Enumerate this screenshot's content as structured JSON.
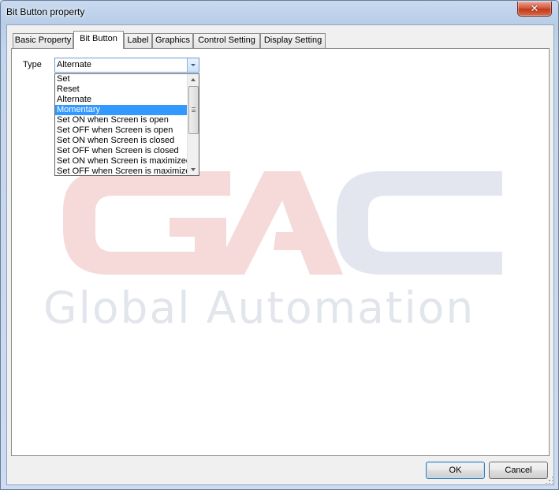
{
  "window": {
    "title": "Bit Button property",
    "close_glyph": "✕"
  },
  "tabs": [
    {
      "label": "Basic Property"
    },
    {
      "label": "Bit Button",
      "active": true
    },
    {
      "label": "Label"
    },
    {
      "label": "Graphics"
    },
    {
      "label": "Control Setting"
    },
    {
      "label": "Display Setting"
    }
  ],
  "form": {
    "type_label": "Type",
    "type_value": "Alternate",
    "type_options": [
      "Set",
      "Reset",
      "Alternate",
      "Momentary",
      "Set ON when Screen is open",
      "Set OFF when Screen is open",
      "Set ON when Screen is closed",
      "Set OFF when Screen is closed",
      "Set ON when Screen is maximized",
      "Set OFF when Screen is maximized"
    ],
    "highlighted_option": "Momentary"
  },
  "watermark": {
    "logo_letters": "GAC",
    "text": "Global Automation",
    "colors": {
      "red": "#f6d9d9",
      "gray": "#e3e6ee"
    }
  },
  "buttons": {
    "ok": "OK",
    "cancel": "Cancel"
  },
  "colors": {
    "selection": "#3399ff",
    "close_button": "#c23a1c"
  }
}
